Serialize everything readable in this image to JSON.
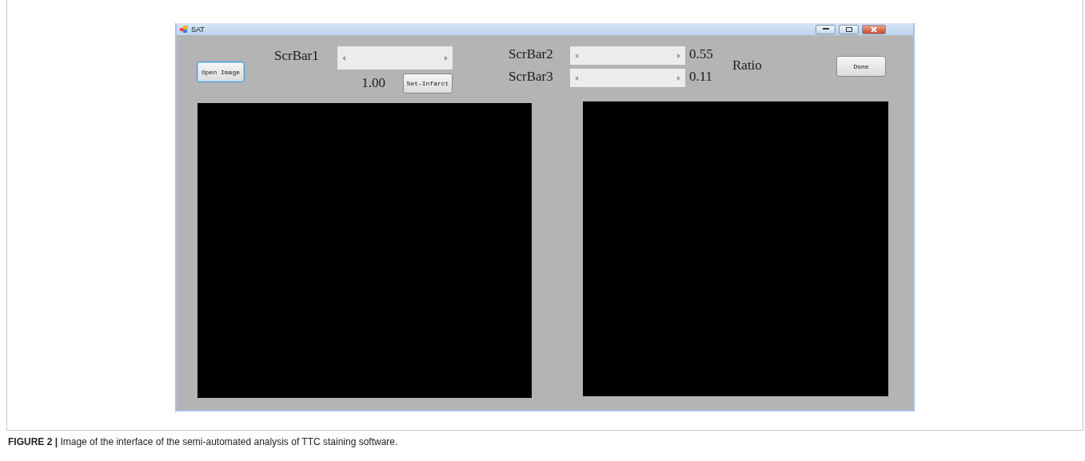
{
  "window": {
    "title": "SAT"
  },
  "open_button": "Open Image",
  "scrollbars": [
    {
      "label": "ScrBar1",
      "reading": "1.00"
    },
    {
      "label": "ScrBar2",
      "reading": "0.55"
    },
    {
      "label": "ScrBar3",
      "reading": "0.11"
    }
  ],
  "set_button": "Set-Infarct",
  "ratio_label": "Ratio",
  "done_button": "Done",
  "caption": "**FIGURE 2 |** Image of the interface of the semi-automated analysis of TTC staining software."
}
